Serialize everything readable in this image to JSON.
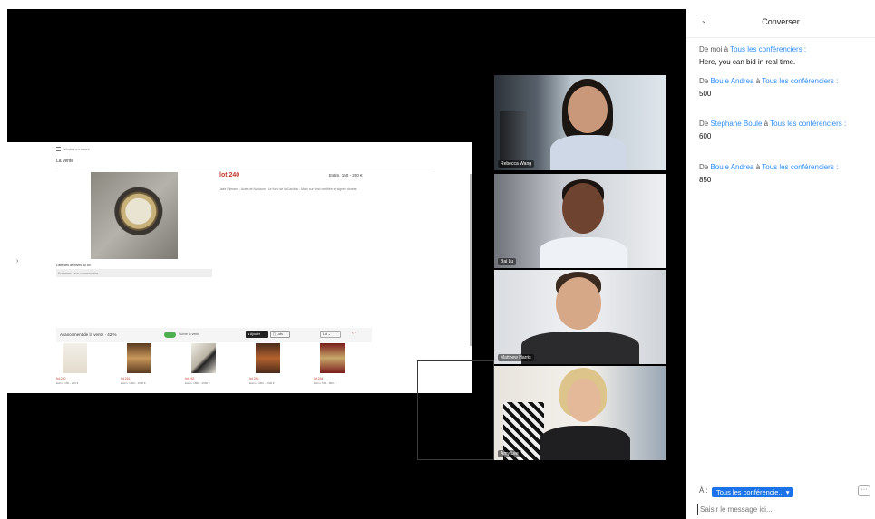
{
  "shared_screen": {
    "header": "Ventes en cours",
    "tab": "La vente",
    "lot_title": "lot 240",
    "estimate": "Estim. 150 - 200 €",
    "description": "Jaëz Plimann ; Acier de Norlaum ; Le fond de la Cardiau ; Mark sur fond certifiée et signée dorées",
    "lot_list_label": "Liste des archives du lot",
    "lot_list_value": "Enchères sans commentaire",
    "progress_text": "Avancement de la vente · 42 %",
    "toggle_label": "Suivre la vente",
    "btn_dark": "● Ajouter",
    "btn_light": "▢ Lots",
    "select_value": "Lot ⌄",
    "arrows": "‹  ›",
    "thumbs": [
      {
        "lot": "lot 240",
        "est": "Estim. 150 - 200 €"
      },
      {
        "lot": "lot 241",
        "est": "Estim. 1000 - 1500 €"
      },
      {
        "lot": "lot 242",
        "est": "Estim. 1800 - 2500 €"
      },
      {
        "lot": "lot 243",
        "est": "Estim. 1300 - 1600 €"
      },
      {
        "lot": "lot 244",
        "est": "Estim. 500 - 800 €"
      }
    ]
  },
  "participants": [
    {
      "name": "Rebecca Wang"
    },
    {
      "name": "Bai Lu"
    },
    {
      "name": "Matthew Harris"
    },
    {
      "name": "Amy Lee"
    }
  ],
  "chat": {
    "title": "Converser",
    "messages": [
      {
        "prefix": "De ",
        "sender": "moi",
        "mid": " à ",
        "target": "Tous les conférenciers",
        "suffix": " :",
        "text": "Here, you can bid in real time."
      },
      {
        "prefix": "De ",
        "sender": "Boule Andrea",
        "mid": " à ",
        "target": "Tous les conférenciers",
        "suffix": " :",
        "text": "500"
      },
      {
        "prefix": "De ",
        "sender": "Stephane Boule",
        "mid": " à ",
        "target": "Tous les conférenciers",
        "suffix": " :",
        "text": "600"
      },
      {
        "prefix": "De ",
        "sender": "Boule Andrea",
        "mid": " à ",
        "target": "Tous les conférenciers",
        "suffix": " :",
        "text": "850"
      }
    ],
    "to_label": "À :",
    "to_value": "Tous les conférencie... ▾",
    "more_label": "···",
    "input_placeholder": "Saisir le message ici..."
  },
  "icons": {
    "chevron": "chevron-down-icon",
    "expand": "chevron-right-icon"
  }
}
